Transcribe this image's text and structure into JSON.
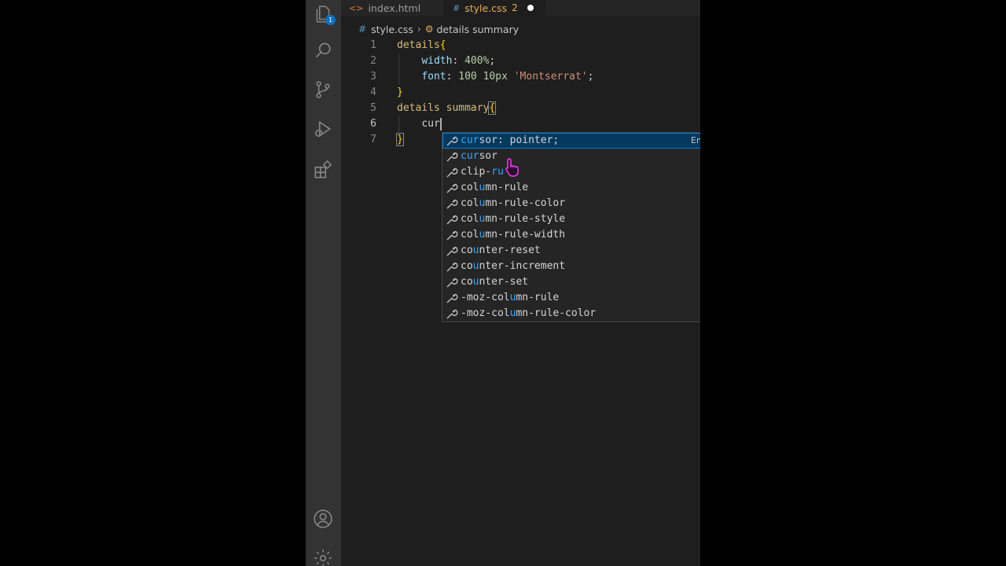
{
  "tabs": [
    {
      "icon": "<>",
      "label": "index.html"
    },
    {
      "icon": "#",
      "label": "style.css",
      "problems": "2"
    }
  ],
  "breadcrumb": {
    "file": "style.css",
    "symbol": "details summary"
  },
  "lines": [
    "1",
    "2",
    "3",
    "4",
    "5",
    "6",
    "7"
  ],
  "code": {
    "l1_sel": "details",
    "l1_brace": "{",
    "l2_prop": "width",
    "l2_val": "400%",
    "l3_prop": "font",
    "l3_val": "100 10px",
    "l3_str": "'Montserrat'",
    "l4_brace": "}",
    "l5_sel": "details summary",
    "l5_brace": "{",
    "l6_typed": "cur",
    "l7_brace": "}"
  },
  "suggestions": {
    "first": {
      "match": "cur",
      "rest": "sor: pointer;"
    },
    "detail": "Em",
    "items": [
      {
        "pre": "",
        "match": "cur",
        "post": "sor"
      },
      {
        "pre": "clip-",
        "match": "ru",
        "post": ""
      },
      {
        "pre": "col",
        "match": "u",
        "post": "mn-rule"
      },
      {
        "pre": "col",
        "match": "u",
        "post": "mn-rule-color"
      },
      {
        "pre": "col",
        "match": "u",
        "post": "mn-rule-style"
      },
      {
        "pre": "col",
        "match": "u",
        "post": "mn-rule-width"
      },
      {
        "pre": "co",
        "match": "u",
        "post": "nter-reset"
      },
      {
        "pre": "co",
        "match": "u",
        "post": "nter-increment"
      },
      {
        "pre": "co",
        "match": "u",
        "post": "nter-set"
      },
      {
        "pre": "-moz-col",
        "match": "u",
        "post": "mn-rule"
      },
      {
        "pre": "-moz-col",
        "match": "u",
        "post": "mn-rule-color"
      }
    ]
  },
  "explorer_badge": "1",
  "colors": {
    "accent": "#2aaaff",
    "tab_modified": "#e8ab53",
    "selection": "#04395e"
  }
}
